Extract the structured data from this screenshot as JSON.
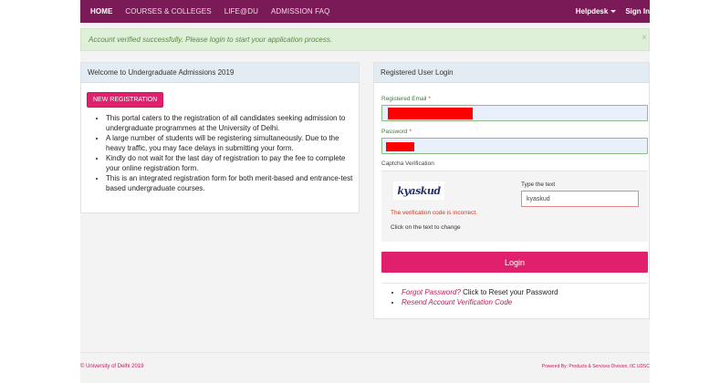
{
  "nav": {
    "items": [
      "HOME",
      "COURSES & COLLEGES",
      "LIFE@DU",
      "ADMISSION FAQ"
    ],
    "helpdesk": "Helpdesk",
    "signin": "Sign In"
  },
  "alert": {
    "message": "Account verified successfully. Please login to start your application process.",
    "close": "×"
  },
  "left_panel": {
    "title": "Welcome to Undergraduate Admissions 2019",
    "new_registration": "NEW REGISTRATION",
    "bullets": [
      "This portal caters to the registration of all candidates seeking admission to undergraduate programmes at the University of Delhi.",
      "A large number of students will be registering simultaneously. Due to the heavy traffic, you may face delays in submitting your form.",
      "Kindly do not wait for the last day of registration to pay the fee to complete your online registration form.",
      "This is an integrated registration form for both merit-based and entrance-test based undergraduate courses."
    ]
  },
  "login_panel": {
    "title": "Registered User Login",
    "email_label": "Registered Email",
    "password_label": "Password",
    "required_mark": "*",
    "captcha_label": "Captcha Verification",
    "captcha_text": "kyaskud",
    "captcha_error": "The verification code is incorrect.",
    "captcha_hint": "Click on the text to change",
    "type_label": "Type the text",
    "type_value": "kyaskud",
    "login_button": "Login",
    "forgot_link": "Forgot Password?",
    "forgot_suffix": " Click to Reset your Password",
    "resend_link": "Resend Account Verification Code"
  },
  "footer": {
    "copyright": "© University of Delhi 2019",
    "powered": "Powered By: Products & Services Division, IIC UDSC"
  },
  "colors": {
    "navbar": "#7a1a56",
    "accent": "#e0206c",
    "alert_bg": "#dff0d8",
    "redaction": "#ff0000"
  }
}
